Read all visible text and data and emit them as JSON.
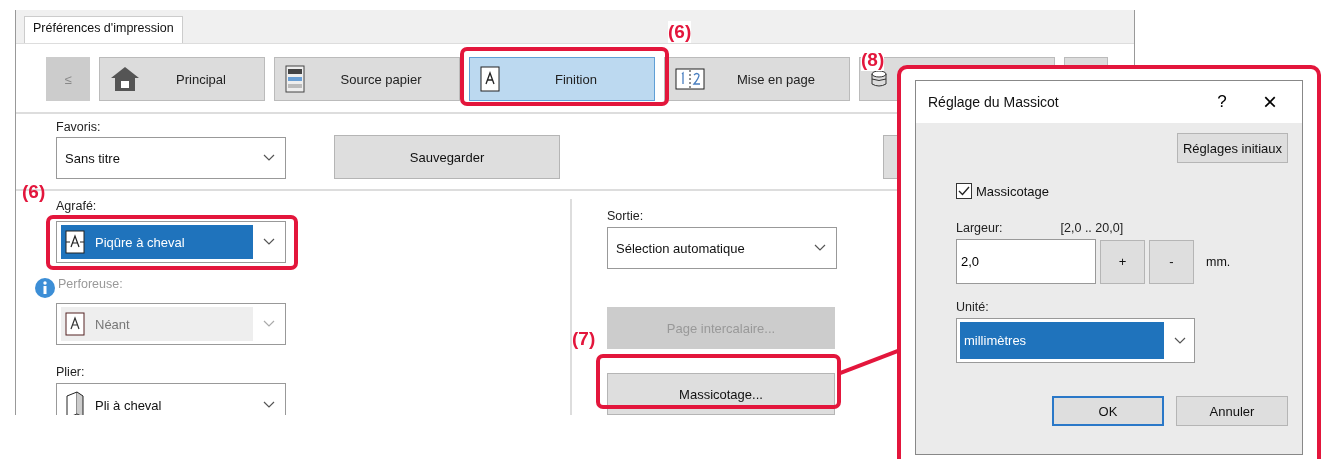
{
  "window": {
    "tab": "Préférences d'impression"
  },
  "toolbar": {
    "back": "≤",
    "tabs": [
      {
        "label": "Principal",
        "kind": "home",
        "selected": false
      },
      {
        "label": "Source papier",
        "kind": "copier",
        "selected": false
      },
      {
        "label": "Finition",
        "kind": "page",
        "selected": true
      },
      {
        "label": "Mise en page",
        "kind": "pages",
        "selected": false
      },
      {
        "kind": "stack",
        "selected": false
      },
      {
        "kind": "blank",
        "selected": false
      }
    ]
  },
  "favorites": {
    "label": "Favoris:",
    "value": "Sans titre",
    "save": "Sauvegarder"
  },
  "staple": {
    "label": "Agrafé:",
    "value": "Piqûre à cheval",
    "highlighted": true
  },
  "punch": {
    "label": "Perforeuse:",
    "value": "Néant",
    "disabled": true
  },
  "fold": {
    "label": "Plier:",
    "value": "Pli à cheval"
  },
  "output": {
    "label": "Sortie:",
    "value": "Sélection automatique"
  },
  "buttons": [
    {
      "label": "Page intercalaire...",
      "disabled": true
    },
    {
      "label": "Massicotage...",
      "disabled": false
    }
  ],
  "dialog": {
    "title": "Réglage du Massicot",
    "help": "?",
    "close": "×",
    "reset": "Réglages initiaux",
    "trim": {
      "label": "Massicotage",
      "checked": true
    },
    "width_label": "Largeur:",
    "range": "[2,0 .. 20,0]",
    "width_value": "2,0",
    "plus": "+",
    "minus": "-",
    "unit_suffix": "mm.",
    "unit": {
      "label": "Unité:",
      "value": "millimètres",
      "highlighted": true
    },
    "buttons": [
      {
        "label": "OK",
        "default": true
      },
      {
        "label": "Annuler",
        "default": false
      }
    ]
  },
  "callouts": [
    "(6)",
    "(6)",
    "(7)",
    "(8)"
  ]
}
